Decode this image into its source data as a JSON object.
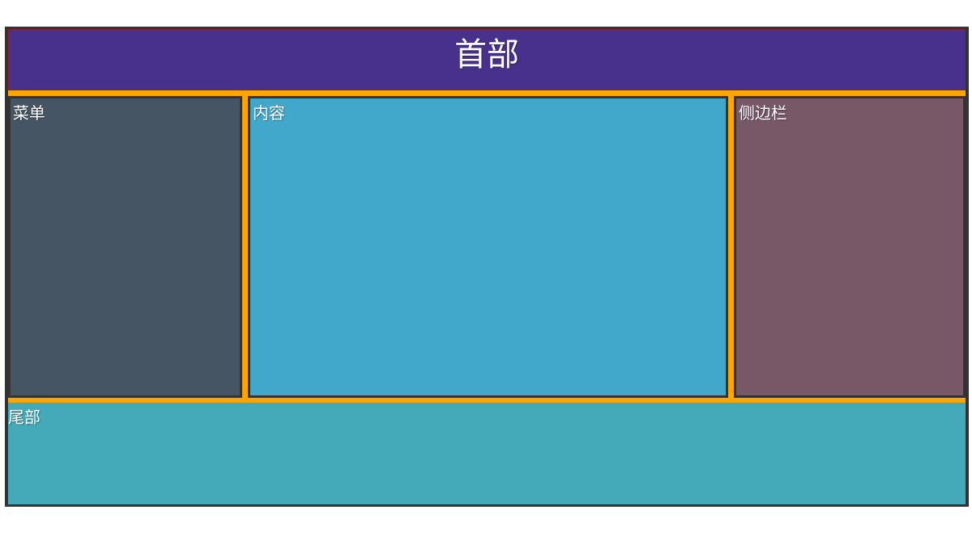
{
  "layout": {
    "header_label": "首部",
    "menu_label": "菜单",
    "content_label": "内容",
    "sidebar_label": "侧边栏",
    "footer_label": "尾部"
  },
  "colors": {
    "header_bg": "#47318c",
    "menu_bg": "#455564",
    "content_bg": "#42a8cb",
    "sidebar_bg": "#785867",
    "footer_bg": "#44a9b9",
    "gap": "#ffa500",
    "frame": "#333333"
  }
}
